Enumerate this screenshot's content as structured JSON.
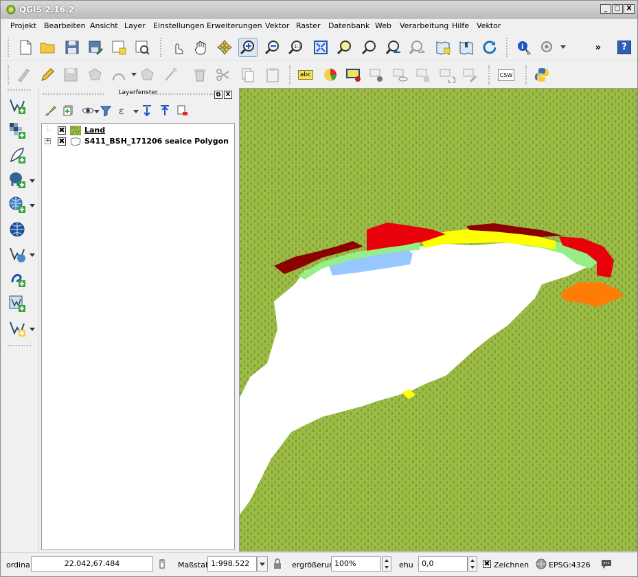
{
  "window": {
    "title": "QGIS 2.16.2",
    "minimize_label": "_",
    "maximize_label": "□",
    "close_label": "X"
  },
  "menu": {
    "items": [
      {
        "label": "Projekt"
      },
      {
        "label": "Bearbeiten"
      },
      {
        "label": "Ansicht"
      },
      {
        "label": "Layer"
      },
      {
        "label": "Einstellungen"
      },
      {
        "label": "Erweiterungen"
      },
      {
        "label": "Vektor"
      },
      {
        "label": "Raster"
      },
      {
        "label": "Datenbank"
      },
      {
        "label": "Web"
      },
      {
        "label": "Verarbeitung"
      },
      {
        "label": "Hilfe"
      },
      {
        "label": "Vektor"
      }
    ]
  },
  "toolbar1": {
    "overflow_label": "»",
    "help_label": "?"
  },
  "toolbar2": {
    "label_abc": "abc",
    "label_csw": "CSW"
  },
  "layers_panel": {
    "title": "Layerfenster",
    "float_label": "⧉",
    "close_label": "X",
    "layers": [
      {
        "name": "Land",
        "checked": "✖",
        "expander": ""
      },
      {
        "name": "S411_BSH_171206 seaice Polygon",
        "checked": "✖",
        "expander": "+"
      }
    ]
  },
  "statusbar": {
    "coord_label": "ordina",
    "coord_value": "22.042,67.484",
    "scale_label": "Maßstab",
    "scale_value": "1:998.522",
    "magnifier_label": "ergrößerun",
    "magnifier_value": "100%",
    "rotation_label": "ehu",
    "rotation_value": "0,0",
    "render_check": "✖",
    "render_label": "Zeichnen",
    "crs_label": "EPSG:4326"
  },
  "colors": {
    "land": "#9bbb45",
    "sea_white": "#ffffff",
    "ice_red": "#e8000b",
    "ice_yellow": "#ffff00",
    "ice_green": "#96ef86",
    "ice_blue": "#96c8ff",
    "ice_orange": "#ff7d07",
    "ice_darkred": "#8b0000"
  }
}
